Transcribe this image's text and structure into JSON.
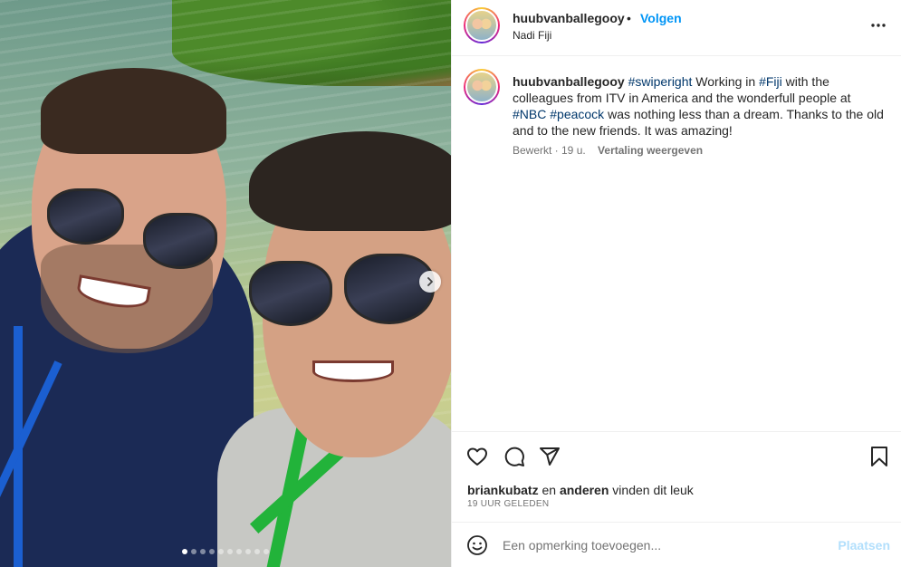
{
  "photo": {
    "carousel_dots": 10,
    "active_dot": 0,
    "next_icon": "chevron-right-icon"
  },
  "header": {
    "username": "huubvanballegooy",
    "bullet": "•",
    "follow_label": "Volgen",
    "location": "Nadi Fiji",
    "more_icon": "more-horizontal-icon"
  },
  "caption": {
    "username": "huubvanballegooy",
    "hashtag_swiperight": "#swiperight",
    "text_1": " Working in ",
    "hashtag_fiji": "#Fiji",
    "text_2": " with the colleagues from ITV in America and the wonderfull people at ",
    "hashtag_nbc": "#NBC",
    "hashtag_peacock": "#peacock",
    "text_3": " was nothing less than a dream. Thanks to the old and to the new friends. It was amazing!",
    "edited": "Bewerkt · 19 u.",
    "translate_label": "Vertaling weergeven"
  },
  "actions": {
    "like_icon": "heart-icon",
    "comment_icon": "comment-icon",
    "share_icon": "send-icon",
    "save_icon": "bookmark-icon"
  },
  "likes": {
    "user": "briankubatz",
    "connector": " en ",
    "others": "anderen",
    "suffix": " vinden dit leuk"
  },
  "timestamp": "19 UUR GELEDEN",
  "comment": {
    "emoji_icon": "emoji-icon",
    "placeholder": "Een opmerking toevoegen...",
    "post_label": "Plaatsen"
  },
  "colors": {
    "accent": "#0095f6",
    "hashtag": "#00376b",
    "muted": "#737373",
    "post_disabled": "#b2dffc"
  }
}
